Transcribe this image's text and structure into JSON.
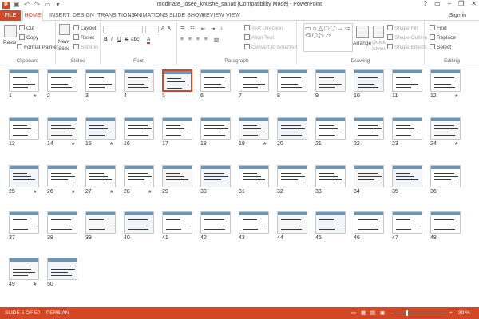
{
  "window": {
    "title": "modiriate_tosee_khushe_sanati [Compatibility Mode] - PowerPoint",
    "app_icon": "P",
    "minimize": "–",
    "restore": "❐",
    "close": "✕",
    "help": "?"
  },
  "tabs": {
    "file": "FILE",
    "home": "HOME",
    "insert": "INSERT",
    "design": "DESIGN",
    "transitions": "TRANSITIONS",
    "animations": "ANIMATIONS",
    "slideshow": "SLIDE SHOW",
    "review": "REVIEW",
    "view": "VIEW",
    "signin": "Sign in"
  },
  "ribbon": {
    "clipboard": {
      "paste": "Paste",
      "cut": "Cut",
      "copy": "Copy",
      "format_painter": "Format Painter",
      "label": "Clipboard"
    },
    "slides": {
      "new_slide": "New Slide",
      "layout": "Layout",
      "reset": "Reset",
      "section": "Section",
      "label": "Slides"
    },
    "font": {
      "label": "Font",
      "bold": "B",
      "italic": "I",
      "underline": "U",
      "strike": "S",
      "shadow": "abc",
      "grow": "A",
      "shrink": "A"
    },
    "paragraph": {
      "text_direction": "Text Direction",
      "align_text": "Align Text",
      "convert_smartart": "Convert to SmartArt",
      "label": "Paragraph"
    },
    "drawing": {
      "arrange": "Arrange",
      "quick_styles": "Quick Styles",
      "shape_fill": "Shape Fill",
      "shape_outline": "Shape Outline",
      "shape_effects": "Shape Effects",
      "label": "Drawing"
    },
    "editing": {
      "find": "Find",
      "replace": "Replace",
      "select": "Select",
      "label": "Editing"
    }
  },
  "slides": [
    {
      "n": "1",
      "star": true
    },
    {
      "n": "2",
      "star": false
    },
    {
      "n": "3",
      "star": false
    },
    {
      "n": "4",
      "star": false
    },
    {
      "n": "5",
      "star": false,
      "selected": true
    },
    {
      "n": "6",
      "star": false
    },
    {
      "n": "7",
      "star": false
    },
    {
      "n": "8",
      "star": false
    },
    {
      "n": "9",
      "star": false
    },
    {
      "n": "10",
      "star": false
    },
    {
      "n": "11",
      "star": false
    },
    {
      "n": "12",
      "star": true
    },
    {
      "n": "13",
      "star": false
    },
    {
      "n": "14",
      "star": true
    },
    {
      "n": "15",
      "star": true
    },
    {
      "n": "16",
      "star": false
    },
    {
      "n": "17",
      "star": false
    },
    {
      "n": "18",
      "star": false
    },
    {
      "n": "19",
      "star": true
    },
    {
      "n": "20",
      "star": false
    },
    {
      "n": "21",
      "star": false
    },
    {
      "n": "22",
      "star": false
    },
    {
      "n": "23",
      "star": false
    },
    {
      "n": "24",
      "star": true
    },
    {
      "n": "25",
      "star": true
    },
    {
      "n": "26",
      "star": true
    },
    {
      "n": "27",
      "star": true
    },
    {
      "n": "28",
      "star": true
    },
    {
      "n": "29",
      "star": false
    },
    {
      "n": "30",
      "star": false
    },
    {
      "n": "31",
      "star": false
    },
    {
      "n": "32",
      "star": false
    },
    {
      "n": "33",
      "star": false
    },
    {
      "n": "34",
      "star": false
    },
    {
      "n": "35",
      "star": false
    },
    {
      "n": "36",
      "star": false
    },
    {
      "n": "37",
      "star": false
    },
    {
      "n": "38",
      "star": false
    },
    {
      "n": "39",
      "star": false
    },
    {
      "n": "40",
      "star": false
    },
    {
      "n": "41",
      "star": false
    },
    {
      "n": "42",
      "star": false
    },
    {
      "n": "43",
      "star": false
    },
    {
      "n": "44",
      "star": false
    },
    {
      "n": "45",
      "star": false
    },
    {
      "n": "46",
      "star": false
    },
    {
      "n": "47",
      "star": false
    },
    {
      "n": "48",
      "star": false
    },
    {
      "n": "49",
      "star": true
    },
    {
      "n": "50",
      "star": false
    }
  ],
  "status": {
    "slide_info": "SLIDE 5 OF 50",
    "language": "PERSIAN",
    "zoom": "30 %",
    "zoom_minus": "–",
    "zoom_plus": "+"
  },
  "colors": {
    "accent": "#d24726",
    "slide_band": "#6a95b6"
  }
}
